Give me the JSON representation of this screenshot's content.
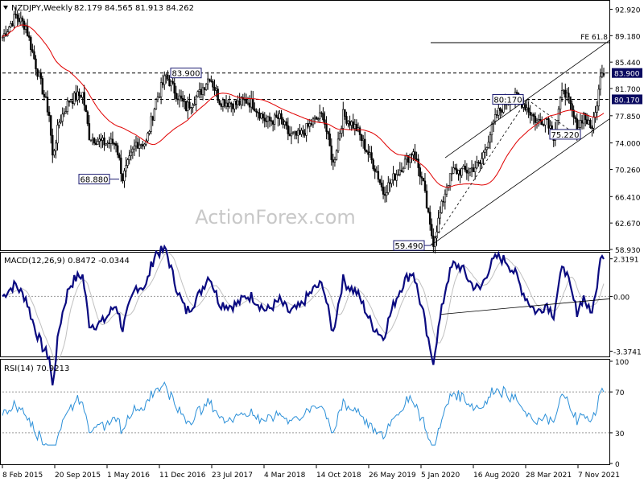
{
  "chart_data": {
    "type": "candlestick",
    "header": {
      "symbol_label": "NZDJPY,Weekly",
      "ohlc": [
        "82.179",
        "84.565",
        "81.913",
        "84.262"
      ]
    },
    "watermark": "ActionForex.com",
    "x_tick_labels": [
      "8 Feb 2015",
      "20 Sep 2015",
      "1 May 2016",
      "11 Dec 2016",
      "23 Jul 2017",
      "4 Mar 2018",
      "14 Oct 2018",
      "26 May 2019",
      "5 Jan 2020",
      "16 Aug 2020",
      "28 Mar 2021",
      "7 Nov 2021"
    ],
    "price_panel": {
      "ylim": [
        58.93,
        94.0
      ],
      "y_ticks": [
        "92.920",
        "89.180",
        "85.440",
        "81.700",
        "77.850",
        "74.000",
        "70.260",
        "66.410",
        "62.670",
        "58.930"
      ],
      "highlight_levels": [
        {
          "label": "83.900",
          "value": 83.9,
          "style": "dashed"
        },
        {
          "label": "80.170",
          "value": 80.17,
          "style": "dashed"
        }
      ],
      "fib_line": {
        "label": "FE 61.8",
        "value": 88.2
      },
      "annotations": [
        "68.880",
        "83.900",
        "59.490",
        "80:170",
        "75.220"
      ],
      "ma_label": "55-week moving average (red)",
      "candles_desc": "weekly OHLC bars, approximated"
    },
    "macd_panel": {
      "label": "MACD(12,26,9) 0.8472 -0.0344",
      "y_ticks": [
        "2.3191",
        "0.00",
        "-3.3741"
      ],
      "ylim": [
        -3.6,
        2.6
      ]
    },
    "rsi_panel": {
      "label": "RSI(14) 70.9213",
      "y_ticks": [
        "100",
        "70",
        "30",
        "0"
      ],
      "ylim": [
        0,
        100
      ]
    },
    "colors": {
      "ma": "#e00000",
      "macd": "#0a0a80",
      "signal": "#c0c0c0",
      "rsi": "#2a8fd8",
      "label_box": "#1a1a70",
      "highlight_bg": "#0a0a60",
      "grid": "#9a9a9a"
    }
  }
}
